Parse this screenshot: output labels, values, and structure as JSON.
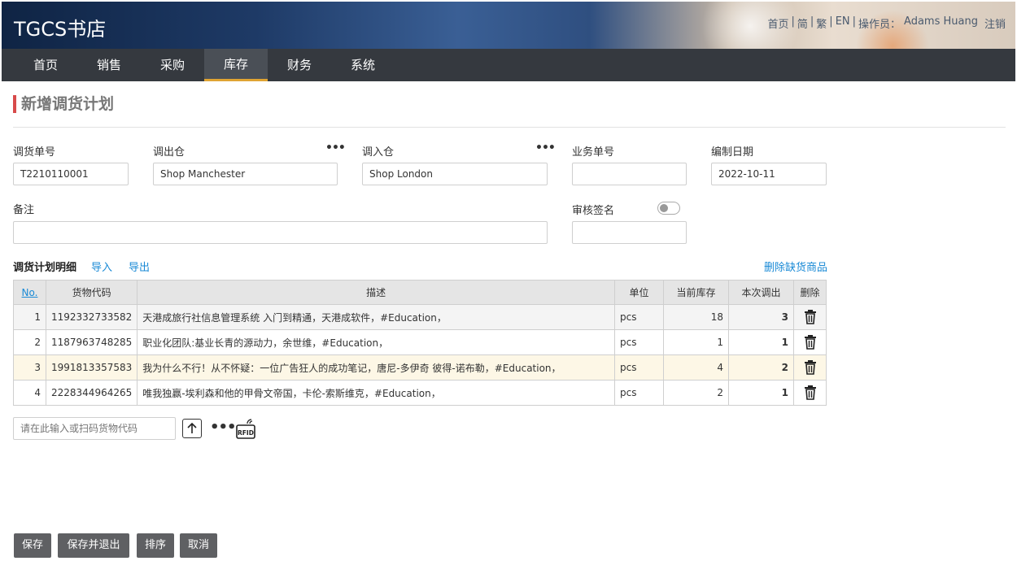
{
  "header": {
    "logo": "TGCS书店",
    "links": {
      "home": "首页",
      "simplified": "简",
      "traditional": "繁",
      "english": "EN",
      "operator_label": "操作员：",
      "operator_name": "Adams Huang",
      "logout": "注销",
      "sep": "|"
    }
  },
  "nav": {
    "items": [
      "首页",
      "销售",
      "采购",
      "库存",
      "财务",
      "系统"
    ],
    "active": "库存"
  },
  "page": {
    "title": "新增调货计划"
  },
  "form": {
    "order_no": {
      "label": "调货单号",
      "value": "T2210110001"
    },
    "from_wh": {
      "label": "调出仓",
      "value": "Shop Manchester"
    },
    "to_wh": {
      "label": "调入仓",
      "value": "Shop London"
    },
    "biz_no": {
      "label": "业务单号",
      "value": ""
    },
    "date": {
      "label": "编制日期",
      "value": "2022-10-11"
    },
    "remark": {
      "label": "备注",
      "value": ""
    },
    "approve": {
      "label": "审核签名",
      "value": "",
      "enabled": false
    }
  },
  "details": {
    "title": "调货计划明细",
    "import": "导入",
    "export": "导出",
    "delete_shortage": "删除缺货商品",
    "columns": [
      "No.",
      "货物代码",
      "描述",
      "单位",
      "当前库存",
      "本次调出",
      "删除"
    ],
    "rows": [
      {
        "no": "1",
        "code": "1192332733582",
        "desc": "天港成旅行社信息管理系统 入门到精通，天港成软件，#Education，",
        "unit": "pcs",
        "stock": "18",
        "qty": "3"
      },
      {
        "no": "2",
        "code": "1187963748285",
        "desc": "职业化团队:基业长青的源动力，余世维，#Education，",
        "unit": "pcs",
        "stock": "1",
        "qty": "1"
      },
      {
        "no": "3",
        "code": "1991813357583",
        "desc": "我为什么不行！从不怀疑：一位广告狂人的成功笔记，唐尼-多伊奇 彼得-诺布勒，#Education，",
        "unit": "pcs",
        "stock": "4",
        "qty": "2"
      },
      {
        "no": "4",
        "code": "2228344964265",
        "desc": "唯我独赢-埃利森和他的甲骨文帝国，卡伦-索斯维克，#Education，",
        "unit": "pcs",
        "stock": "2",
        "qty": "1"
      }
    ]
  },
  "scan": {
    "placeholder": "请在此输入或扫码货物代码"
  },
  "actions": {
    "save": "保存",
    "save_exit": "保存并退出",
    "sort": "排序",
    "cancel": "取消"
  },
  "colors": {
    "nav_bg": "#35393f",
    "active_underline": "#e0a433",
    "title_bar": "#d84b4b",
    "link": "#1a8ad6",
    "button_bg": "#5f6063",
    "highlight_row": "#fdf7e6"
  },
  "icons": [
    "trash-icon",
    "upload-arrow-icon",
    "more-dots-icon",
    "rfid-icon"
  ]
}
